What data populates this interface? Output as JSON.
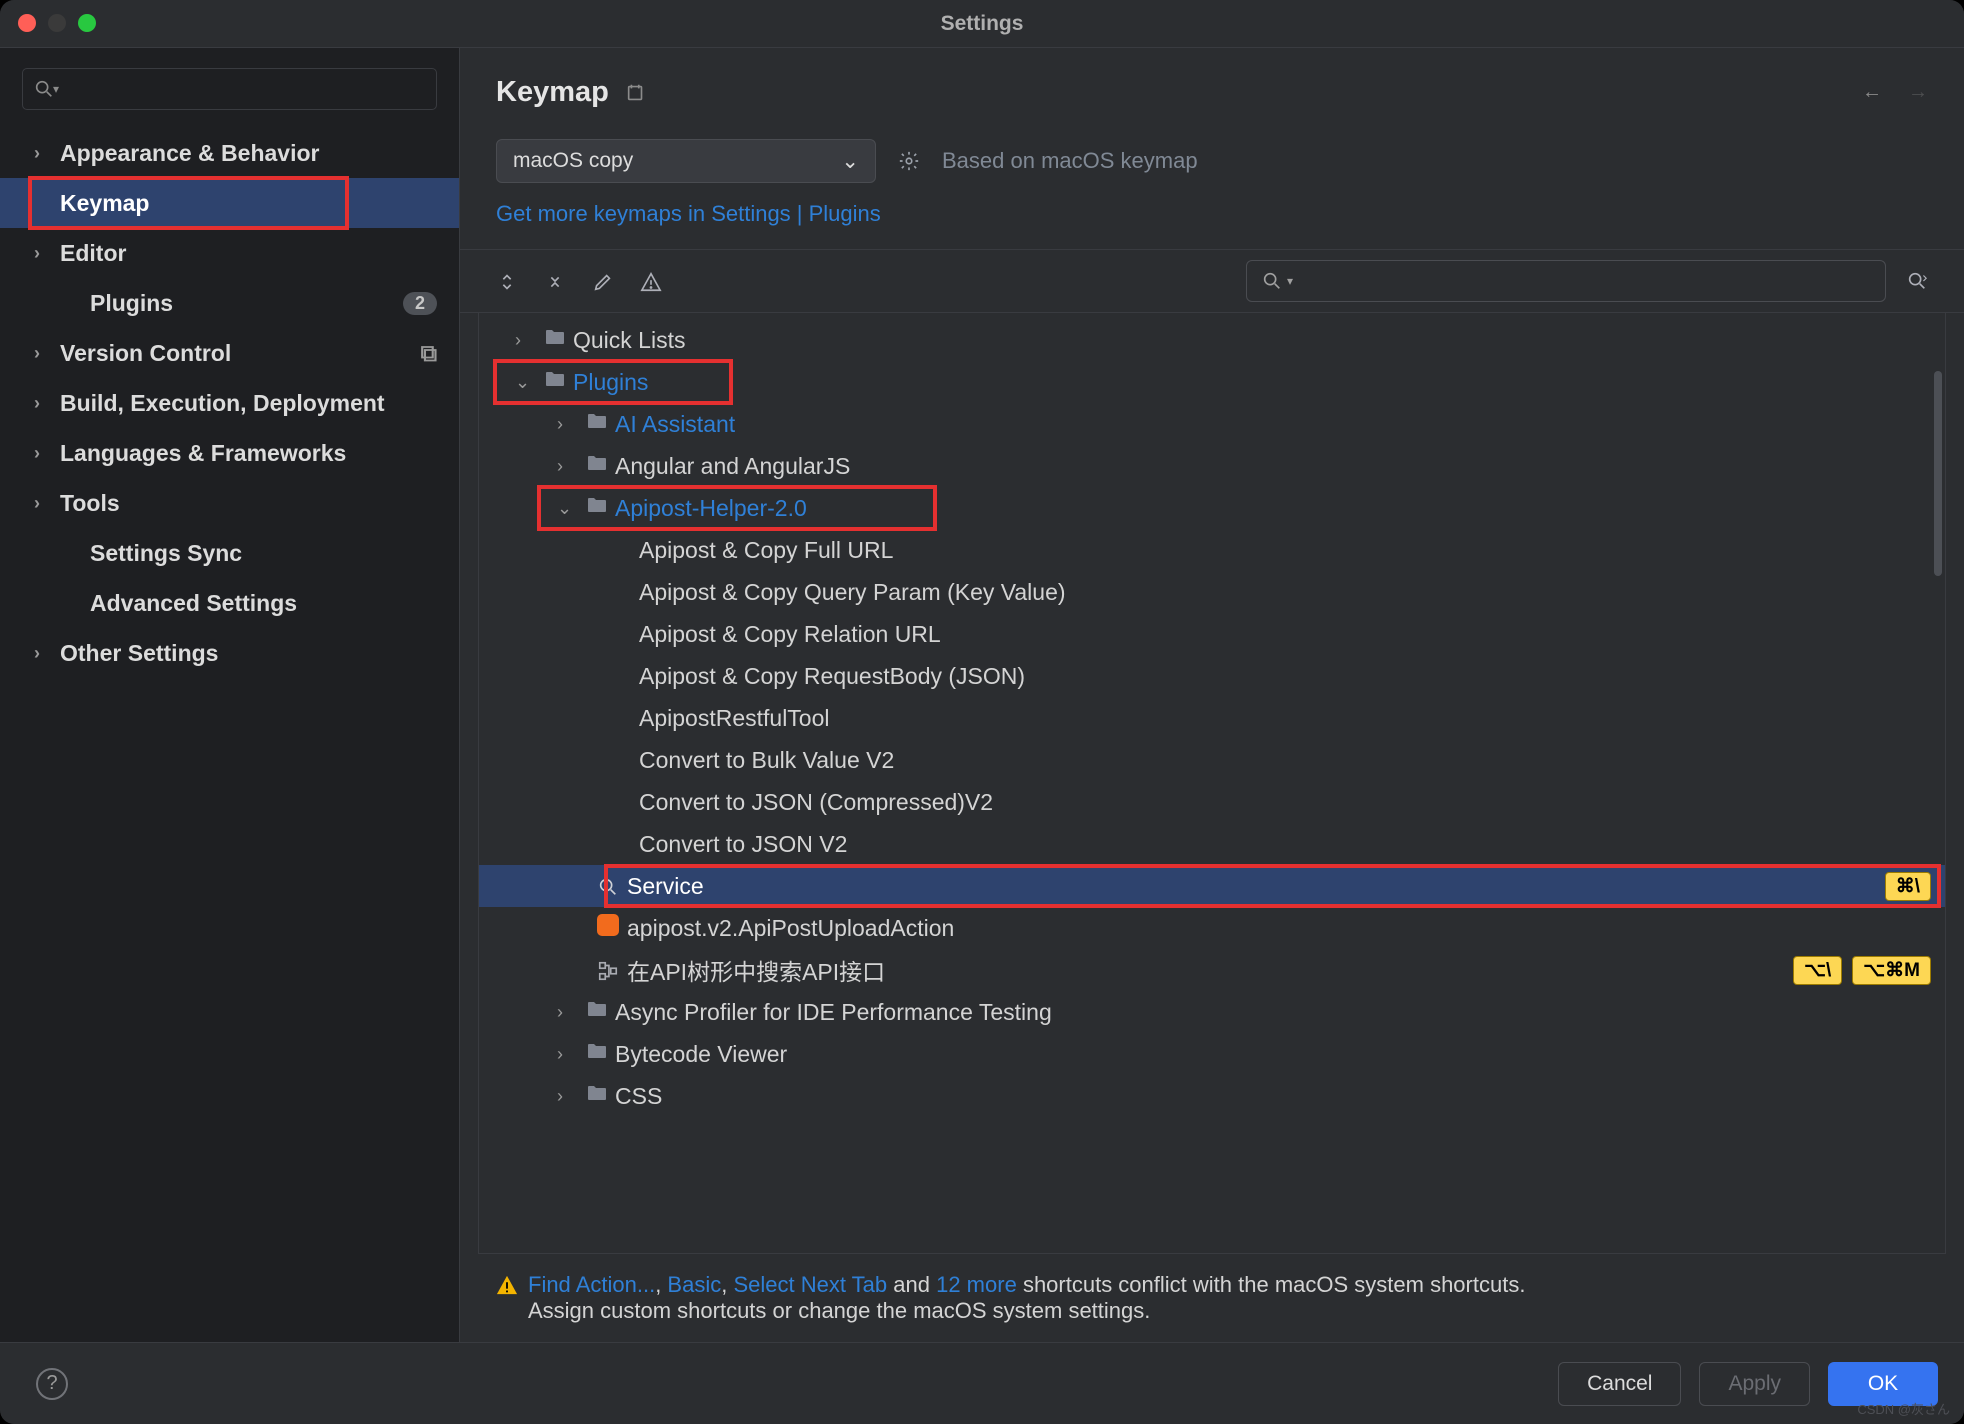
{
  "window": {
    "title": "Settings"
  },
  "sidebar": {
    "search_placeholder": "",
    "items": [
      {
        "label": "Appearance & Behavior",
        "expandable": true
      },
      {
        "label": "Keymap",
        "expandable": false,
        "selected": true,
        "highlight": true
      },
      {
        "label": "Editor",
        "expandable": true
      },
      {
        "label": "Plugins",
        "expandable": false,
        "badge": "2"
      },
      {
        "label": "Version Control",
        "expandable": true,
        "popout": true
      },
      {
        "label": "Build, Execution, Deployment",
        "expandable": true
      },
      {
        "label": "Languages & Frameworks",
        "expandable": true
      },
      {
        "label": "Tools",
        "expandable": true
      },
      {
        "label": "Settings Sync",
        "expandable": false
      },
      {
        "label": "Advanced Settings",
        "expandable": false
      },
      {
        "label": "Other Settings",
        "expandable": true
      }
    ]
  },
  "header": {
    "title": "Keymap"
  },
  "keymap_select": {
    "value": "macOS copy",
    "based_on": "Based on macOS keymap"
  },
  "link_line": {
    "prefix": "Get more keymaps in Settings | ",
    "link": "Plugins"
  },
  "tree": [
    {
      "indent": 1,
      "chev": "right",
      "icon": "folder",
      "label": "Quick Lists"
    },
    {
      "indent": 1,
      "chev": "down",
      "icon": "folder",
      "label": "Plugins",
      "link": true,
      "highlight": true
    },
    {
      "indent": 2,
      "chev": "right",
      "icon": "folder",
      "label": "AI Assistant",
      "link": true
    },
    {
      "indent": 2,
      "chev": "right",
      "icon": "folder",
      "label": "Angular and AngularJS"
    },
    {
      "indent": 2,
      "chev": "down",
      "icon": "folder",
      "label": "Apipost-Helper-2.0",
      "link": true,
      "highlight": true
    },
    {
      "indent": 4,
      "label": "Apipost & Copy Full URL"
    },
    {
      "indent": 4,
      "label": "Apipost & Copy Query Param (Key Value)"
    },
    {
      "indent": 4,
      "label": "Apipost & Copy Relation URL"
    },
    {
      "indent": 4,
      "label": "Apipost & Copy RequestBody (JSON)"
    },
    {
      "indent": 4,
      "label": "ApipostRestfulTool"
    },
    {
      "indent": 4,
      "label": "Convert to Bulk Value V2"
    },
    {
      "indent": 4,
      "label": "Convert to JSON (Compressed)V2"
    },
    {
      "indent": 4,
      "label": "Convert to JSON V2"
    },
    {
      "indent": 3,
      "icon": "search",
      "label": "Service",
      "selected": true,
      "shortcut1": "⌘\\",
      "highlight": true
    },
    {
      "indent": 3,
      "icon": "orange",
      "label": "apipost.v2.ApiPostUploadAction"
    },
    {
      "indent": 3,
      "icon": "tree",
      "label": "在API树形中搜索API接口",
      "shortcut1": "⌥\\",
      "shortcut2": "⌥⌘M"
    },
    {
      "indent": 2,
      "chev": "right",
      "icon": "folder",
      "label": "Async Profiler for IDE Performance Testing"
    },
    {
      "indent": 2,
      "chev": "right",
      "icon": "folder",
      "label": "Bytecode Viewer"
    },
    {
      "indent": 2,
      "chev": "right",
      "icon": "folder",
      "label": "CSS"
    }
  ],
  "warning": {
    "links": [
      "Find Action...",
      "Basic",
      "Select Next Tab"
    ],
    "more_link": "12 more",
    "text1": " and ",
    "text2": " shortcuts conflict with the macOS system shortcuts.",
    "line2": "Assign custom shortcuts or change the macOS system settings."
  },
  "footer": {
    "cancel": "Cancel",
    "apply": "Apply",
    "ok": "OK"
  },
  "watermark": "CSDN @灰さん"
}
